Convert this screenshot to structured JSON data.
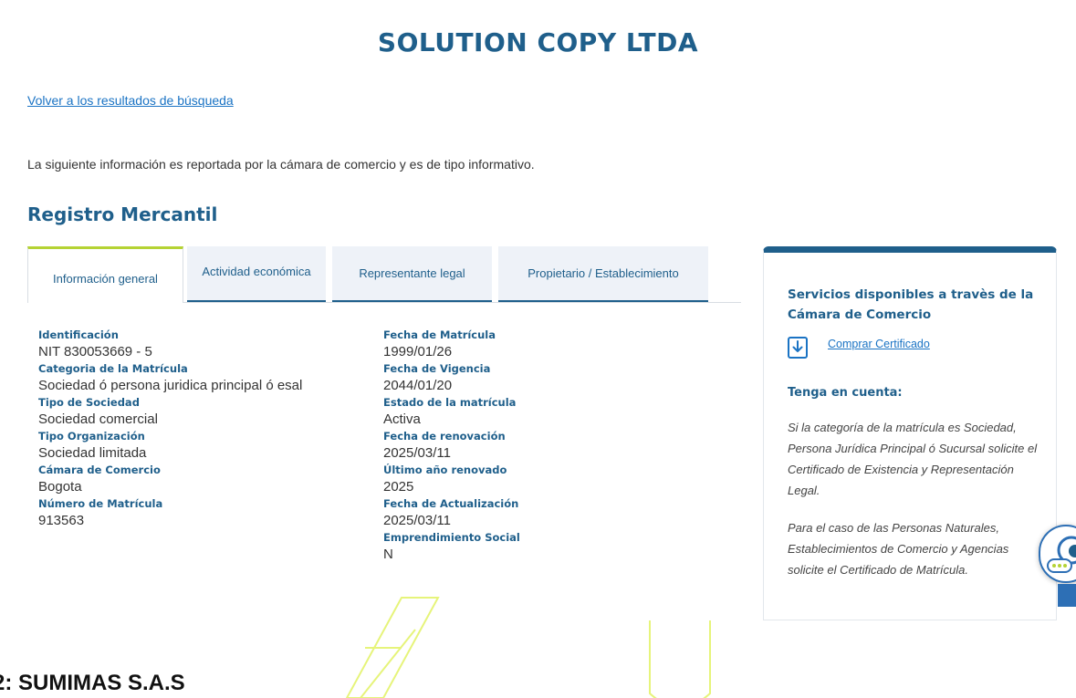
{
  "company": {
    "name": "SOLUTION COPY LTDA"
  },
  "back_link": "Volver a los resultados de búsqueda",
  "intro": "La siguiente información es reportada por la cámara de comercio y es de tipo informativo.",
  "section_title": "Registro Mercantil",
  "tabs": [
    {
      "label": "Información general",
      "active": true
    },
    {
      "label": "Actividad económica",
      "active": false
    },
    {
      "label": "Representante legal",
      "active": false
    },
    {
      "label": "Propietario / Establecimiento",
      "active": false
    }
  ],
  "left_fields": [
    {
      "label": "Identificación",
      "value": "NIT 830053669 - 5"
    },
    {
      "label": "Categoria de la Matrícula",
      "value": "Sociedad ó persona juridica principal ó esal"
    },
    {
      "label": "Tipo de Sociedad",
      "value": "Sociedad comercial"
    },
    {
      "label": "Tipo Organización",
      "value": "Sociedad limitada"
    },
    {
      "label": "Cámara de Comercio",
      "value": "Bogota"
    },
    {
      "label": "Número de Matrícula",
      "value": "913563"
    }
  ],
  "right_fields": [
    {
      "label": "Fecha de Matrícula",
      "value": "1999/01/26"
    },
    {
      "label": "Fecha de Vigencia",
      "value": "2044/01/20"
    },
    {
      "label": "Estado de la matrícula",
      "value": "Activa"
    },
    {
      "label": "Fecha de renovación",
      "value": "2025/03/11"
    },
    {
      "label": "Último año renovado",
      "value": "2025"
    },
    {
      "label": "Fecha de Actualización",
      "value": "2025/03/11"
    },
    {
      "label": "Emprendimiento Social",
      "value": "N"
    }
  ],
  "side_panel": {
    "title": "Servicios disponibles a travès de la Cámara de Comercio",
    "certificate_link": "Comprar Certificado",
    "note_title": "Tenga en cuenta:",
    "note_1": "Si la categoría de la matrícula es Sociedad, Persona Jurídica Principal ó Sucursal solicite el Certificado de Existencia y Representación Legal.",
    "note_2": "Para el caso de las Personas Naturales, Establecimientos de Comercio y Agencias solicite el Certificado de Matrícula."
  },
  "footer_heading": "2: SUMIMAS S.A.S",
  "colors": {
    "primary": "#1f5f8b",
    "link": "#1a73c4",
    "tab_active_accent": "#b5d334",
    "watermark": "#e6f47a"
  },
  "icons": {
    "download": "download-icon",
    "chat": "chat-assistant-icon"
  }
}
